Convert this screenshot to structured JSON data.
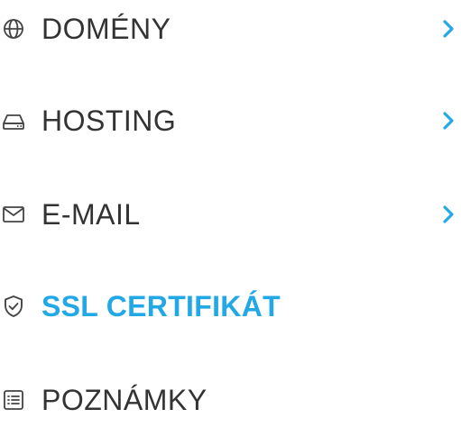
{
  "colors": {
    "text": "#333333",
    "icon": "#444444",
    "active": "#22a8e6",
    "chevron": "#22a8e6"
  },
  "menu": {
    "items": [
      {
        "label": "DOMÉNY",
        "icon": "globe-icon",
        "has_submenu": true,
        "active": false
      },
      {
        "label": "HOSTING",
        "icon": "hard-drive-icon",
        "has_submenu": true,
        "active": false
      },
      {
        "label": "E-MAIL",
        "icon": "envelope-icon",
        "has_submenu": true,
        "active": false
      },
      {
        "label": "SSL CERTIFIKÁT",
        "icon": "shield-check-icon",
        "has_submenu": false,
        "active": true
      },
      {
        "label": "POZNÁMKY",
        "icon": "list-icon",
        "has_submenu": false,
        "active": false
      }
    ]
  }
}
